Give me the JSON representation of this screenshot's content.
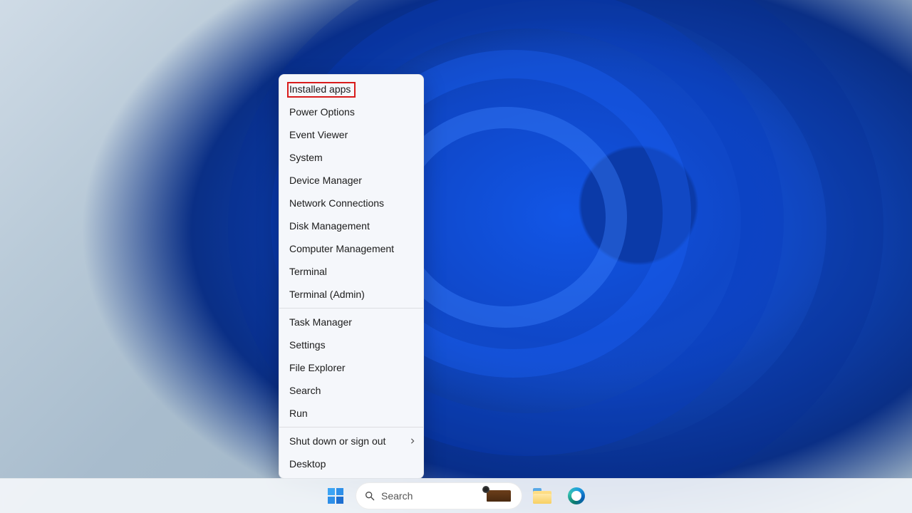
{
  "taskbar": {
    "search_placeholder": "Search",
    "icons": {
      "start": "start-icon",
      "search": "search-icon",
      "file_explorer": "file-explorer-icon",
      "edge": "edge-icon"
    }
  },
  "context_menu": {
    "items": [
      {
        "label": "Installed apps",
        "highlighted": true
      },
      {
        "label": "Power Options"
      },
      {
        "label": "Event Viewer"
      },
      {
        "label": "System"
      },
      {
        "label": "Device Manager"
      },
      {
        "label": "Network Connections"
      },
      {
        "label": "Disk Management"
      },
      {
        "label": "Computer Management"
      },
      {
        "label": "Terminal"
      },
      {
        "label": "Terminal (Admin)"
      },
      {
        "separator": true
      },
      {
        "label": "Task Manager"
      },
      {
        "label": "Settings"
      },
      {
        "label": "File Explorer"
      },
      {
        "label": "Search"
      },
      {
        "label": "Run"
      },
      {
        "separator": true
      },
      {
        "label": "Shut down or sign out",
        "submenu": true
      },
      {
        "label": "Desktop"
      }
    ]
  },
  "annotation": {
    "highlight_target_label": "Installed apps",
    "highlight_color": "#d81b1b"
  }
}
